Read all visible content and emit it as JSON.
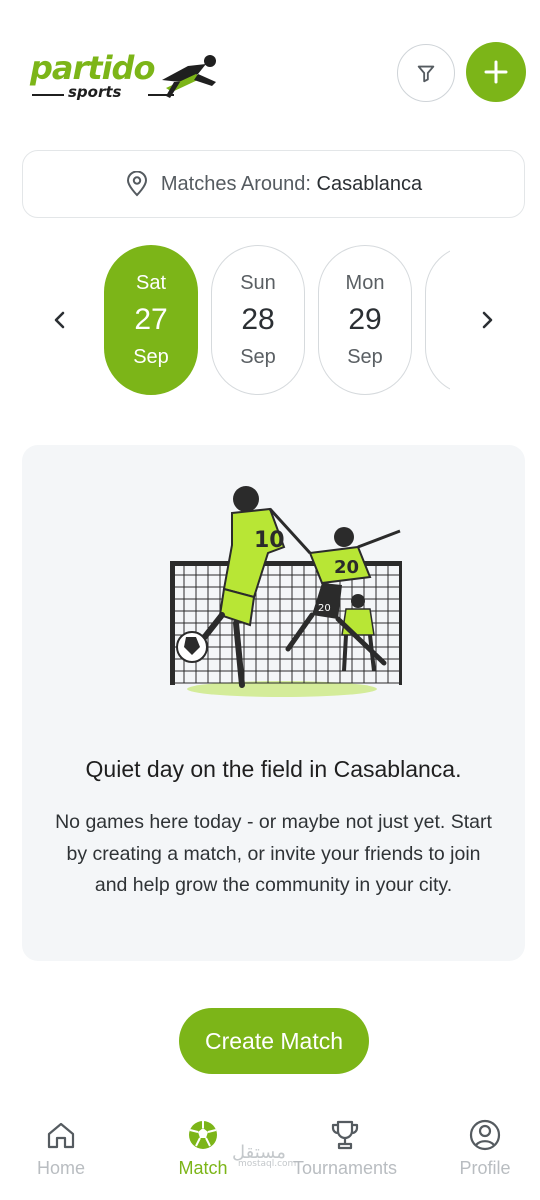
{
  "brand": {
    "name": "partido",
    "sub": "sports",
    "accent": "#7cb518"
  },
  "header": {
    "filter_icon": "filter-icon",
    "add_icon": "plus-icon"
  },
  "location": {
    "label": "Matches Around:",
    "city": "Casablanca"
  },
  "dates": [
    {
      "dow": "Sat",
      "day": "27",
      "month": "Sep",
      "selected": true
    },
    {
      "dow": "Sun",
      "day": "28",
      "month": "Sep",
      "selected": false
    },
    {
      "dow": "Mon",
      "day": "29",
      "month": "Sep",
      "selected": false
    }
  ],
  "empty_state": {
    "title": "Quiet day on the field in Casablanca.",
    "body": "No games here today - or maybe not just yet. Start by creating a match, or invite your friends to join and help grow the community in your city.",
    "jersey_numbers": [
      "10",
      "20",
      "20"
    ]
  },
  "cta": {
    "label": "Create Match"
  },
  "nav": [
    {
      "label": "Home",
      "icon": "home-icon",
      "active": false
    },
    {
      "label": "Match",
      "icon": "soccer-ball-icon",
      "active": true
    },
    {
      "label": "Tournaments",
      "icon": "trophy-icon",
      "active": false
    },
    {
      "label": "Profile",
      "icon": "user-circle-icon",
      "active": false
    }
  ],
  "watermark": {
    "text": "مستقل",
    "sub": "mostaql.com"
  }
}
